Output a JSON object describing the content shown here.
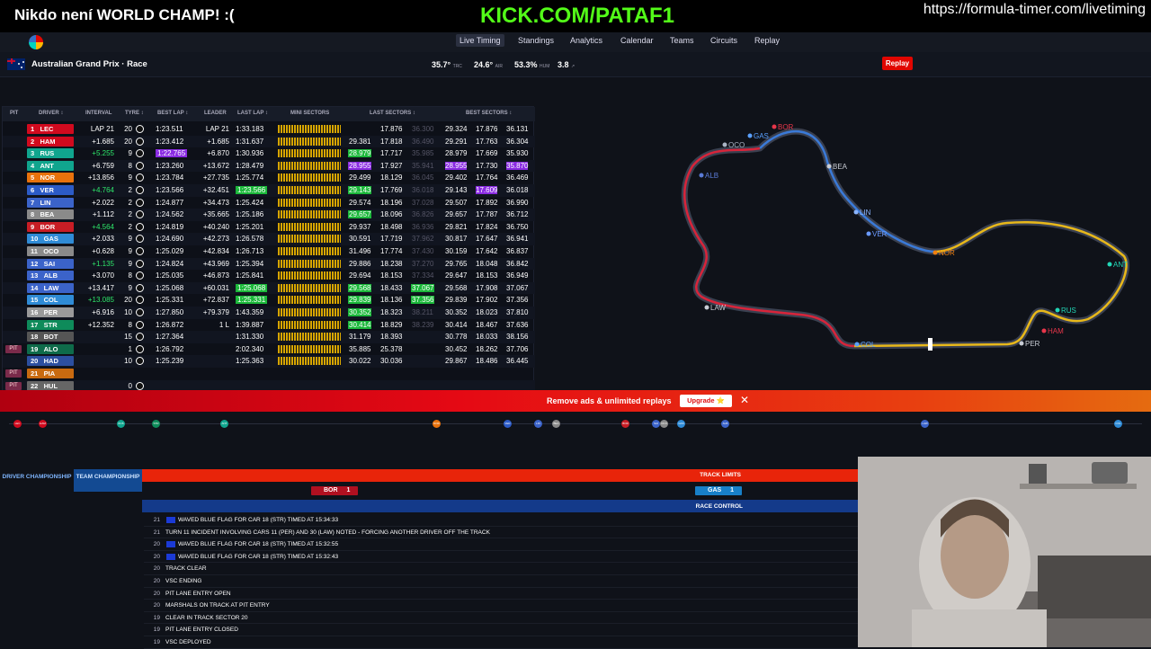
{
  "overlay": {
    "left_text": "Nikdo není WORLD CHAMP! :(",
    "center_text": "KICK.COM/PATAF1",
    "right_text": "https://formula-timer.com/livetiming"
  },
  "nav": {
    "items": [
      "Live Timing",
      "Standings",
      "Analytics",
      "Calendar",
      "Teams",
      "Circuits",
      "Replay"
    ]
  },
  "session": {
    "title": "Australian Grand Prix · Race",
    "track_temp": "35.7°",
    "track_unit": "TRC",
    "air_temp": "24.6°",
    "air_unit": "AIR",
    "humidity": "53.3%",
    "humidity_unit": "HUM",
    "wind": "3.8",
    "replay_label": "Replay"
  },
  "table": {
    "headers": [
      "PIT",
      "DRIVER ↕",
      "INTERVAL",
      "TYRE ↕",
      "BEST LAP ↕",
      "LEADER",
      "LAST LAP ↕",
      "MINI SECTORS",
      "LAST SECTORS ↕",
      "BEST SECTORS ↕"
    ],
    "rows": [
      {
        "pos": "1",
        "code": "LEC",
        "color": "#d10a1e",
        "interval": "LAP 21",
        "tl": "20",
        "best": "1:23.511",
        "leader": "LAP 21",
        "last": "1:33.183",
        "ls1": "17.876",
        "ls2": "36.300",
        "bs0": "29.324",
        "bs1": "17.876",
        "bs2": "36.131",
        "ls0": ""
      },
      {
        "pos": "2",
        "code": "HAM",
        "color": "#d10a1e",
        "interval": "+1.685",
        "tl": "20",
        "best": "1:23.412",
        "leader": "+1.685",
        "last": "1:31.637",
        "ls0": "29.381",
        "ls1": "17.818",
        "ls2": "36.490",
        "bs0": "29.291",
        "bs1": "17.763",
        "bs2": "36.304"
      },
      {
        "pos": "3",
        "code": "RUS",
        "color": "#10a58e",
        "interval": "+5.255",
        "tl": "9",
        "best": "1:22.765",
        "leader": "+6.870",
        "last": "1:30.936",
        "ls0": "28.979",
        "ls1": "17.717",
        "ls2": "35.985",
        "bs0": "28.979",
        "bs1": "17.669",
        "bs2": "35.930"
      },
      {
        "pos": "4",
        "code": "ANT",
        "color": "#10a58e",
        "interval": "+6.759",
        "tl": "8",
        "best": "1:23.260",
        "leader": "+13.672",
        "last": "1:28.479",
        "ls0": "28.955",
        "ls1": "17.927",
        "ls2": "35.941",
        "bs0": "28.955",
        "bs1": "17.730",
        "bs2": "35.870"
      },
      {
        "pos": "5",
        "code": "NOR",
        "color": "#e8720c",
        "interval": "+13.856",
        "tl": "9",
        "best": "1:23.784",
        "leader": "+27.735",
        "last": "1:25.774",
        "ls0": "29.499",
        "ls1": "18.129",
        "ls2": "36.045",
        "bs0": "29.402",
        "bs1": "17.764",
        "bs2": "36.469"
      },
      {
        "pos": "6",
        "code": "VER",
        "color": "#2c5bc7",
        "interval": "+4.764",
        "tl": "2",
        "best": "1:23.566",
        "leader": "+32.451",
        "last": "1:23.566",
        "ls0": "29.143",
        "ls1": "17.769",
        "ls2": "36.018",
        "bs0": "29.143",
        "bs1": "17.609",
        "bs2": "36.018"
      },
      {
        "pos": "7",
        "code": "LIN",
        "color": "#3b63c9",
        "interval": "+2.022",
        "tl": "2",
        "best": "1:24.877",
        "leader": "+34.473",
        "last": "1:25.424",
        "ls0": "29.574",
        "ls1": "18.196",
        "ls2": "37.028",
        "bs0": "29.507",
        "bs1": "17.892",
        "bs2": "36.990"
      },
      {
        "pos": "8",
        "code": "BEA",
        "color": "#8a8a8a",
        "interval": "+1.112",
        "tl": "2",
        "best": "1:24.562",
        "leader": "+35.665",
        "last": "1:25.186",
        "ls0": "29.657",
        "ls1": "18.096",
        "ls2": "36.826",
        "bs0": "29.657",
        "bs1": "17.787",
        "bs2": "36.712"
      },
      {
        "pos": "9",
        "code": "BOR",
        "color": "#c81d25",
        "interval": "+4.564",
        "tl": "2",
        "best": "1:24.819",
        "leader": "+40.240",
        "last": "1:25.201",
        "ls0": "29.937",
        "ls1": "18.498",
        "ls2": "36.936",
        "bs0": "29.821",
        "bs1": "17.824",
        "bs2": "36.750"
      },
      {
        "pos": "10",
        "code": "GAS",
        "color": "#2f8bd6",
        "interval": "+2.033",
        "tl": "9",
        "best": "1:24.690",
        "leader": "+42.273",
        "last": "1:26.578",
        "ls0": "30.591",
        "ls1": "17.719",
        "ls2": "37.962",
        "bs0": "30.817",
        "bs1": "17.647",
        "bs2": "36.941"
      },
      {
        "pos": "11",
        "code": "OCO",
        "color": "#8a8a8a",
        "interval": "+0.628",
        "tl": "9",
        "best": "1:25.029",
        "leader": "+42.834",
        "last": "1:26.713",
        "ls0": "31.496",
        "ls1": "17.774",
        "ls2": "37.430",
        "bs0": "30.159",
        "bs1": "17.642",
        "bs2": "36.837"
      },
      {
        "pos": "12",
        "code": "SAI",
        "color": "#3b63c9",
        "interval": "+1.135",
        "tl": "9",
        "best": "1:24.824",
        "leader": "+43.969",
        "last": "1:25.394",
        "ls0": "29.886",
        "ls1": "18.238",
        "ls2": "37.270",
        "bs0": "29.765",
        "bs1": "18.048",
        "bs2": "36.842"
      },
      {
        "pos": "13",
        "code": "ALB",
        "color": "#3b63c9",
        "interval": "+3.070",
        "tl": "8",
        "best": "1:25.035",
        "leader": "+46.873",
        "last": "1:25.841",
        "ls0": "29.694",
        "ls1": "18.153",
        "ls2": "37.334",
        "bs0": "29.647",
        "bs1": "18.153",
        "bs2": "36.949"
      },
      {
        "pos": "14",
        "code": "LAW",
        "color": "#3b63c9",
        "interval": "+13.417",
        "tl": "9",
        "best": "1:25.068",
        "leader": "+60.031",
        "last": "1:25.068",
        "ls0": "29.568",
        "ls1": "18.433",
        "ls2": "37.067",
        "bs0": "29.568",
        "bs1": "17.908",
        "bs2": "37.067"
      },
      {
        "pos": "15",
        "code": "COL",
        "color": "#2f8bd6",
        "interval": "+13.085",
        "tl": "20",
        "best": "1:25.331",
        "leader": "+72.837",
        "last": "1:25.331",
        "ls0": "29.839",
        "ls1": "18.136",
        "ls2": "37.356",
        "bs0": "29.839",
        "bs1": "17.902",
        "bs2": "37.356"
      },
      {
        "pos": "16",
        "code": "PER",
        "color": "#9a9a9a",
        "interval": "+6.916",
        "tl": "10",
        "best": "1:27.850",
        "leader": "+79.379",
        "last": "1:43.359",
        "ls0": "30.352",
        "ls1": "18.323",
        "ls2": "38.211",
        "bs0": "30.352",
        "bs1": "18.023",
        "bs2": "37.810"
      },
      {
        "pos": "17",
        "code": "STR",
        "color": "#0e8b5a",
        "interval": "+12.352",
        "tl": "8",
        "best": "1:26.872",
        "leader": "1 L",
        "last": "1:39.887",
        "ls0": "30.414",
        "ls1": "18.829",
        "ls2": "38.239",
        "bs0": "30.414",
        "bs1": "18.467",
        "bs2": "37.636"
      },
      {
        "pos": "18",
        "code": "BOT",
        "color": "#555555",
        "interval": "",
        "tl": "15",
        "best": "1:27.364",
        "leader": "",
        "last": "1:31.330",
        "ls0": "31.179",
        "ls1": "18.393",
        "ls2": "",
        "bs0": "30.778",
        "bs1": "18.033",
        "bs2": "38.156"
      },
      {
        "pos": "19",
        "code": "ALO",
        "color": "#0e6b4a",
        "interval": "",
        "tl": "1",
        "best": "1:26.792",
        "leader": "",
        "last": "2:02.340",
        "ls0": "35.885",
        "ls1": "25.378",
        "ls2": "",
        "bs0": "30.452",
        "bs1": "18.262",
        "bs2": "37.706",
        "pit": "PIT"
      },
      {
        "pos": "20",
        "code": "HAD",
        "color": "#2c4fa0",
        "interval": "",
        "tl": "10",
        "best": "1:25.239",
        "leader": "",
        "last": "1:25.363",
        "ls0": "30.022",
        "ls1": "30.036",
        "ls2": "",
        "bs0": "29.867",
        "bs1": "18.486",
        "bs2": "36.445"
      },
      {
        "pos": "21",
        "code": "PIA",
        "color": "#c86a10",
        "interval": "",
        "tl": "",
        "best": "",
        "leader": "",
        "last": "",
        "ls0": "",
        "ls1": "",
        "ls2": "",
        "bs0": "",
        "bs1": "",
        "bs2": "",
        "pit": "PIT"
      },
      {
        "pos": "22",
        "code": "HUL",
        "color": "#666666",
        "interval": "",
        "tl": "0",
        "best": "",
        "leader": "",
        "last": "",
        "ls0": "",
        "ls1": "",
        "ls2": "",
        "bs0": "",
        "bs1": "",
        "bs2": "",
        "pit": "PIT"
      }
    ]
  },
  "track": {
    "labels": [
      {
        "code": "BOR",
        "color": "#e8364a"
      },
      {
        "code": "GAS",
        "color": "#5aa0ff"
      },
      {
        "code": "OCO",
        "color": "#aab4c4"
      },
      {
        "code": "BEA",
        "color": "#c8ccd4"
      },
      {
        "code": "ALB",
        "color": "#5a7bd6"
      },
      {
        "code": "LIN",
        "color": "#8ab4ff"
      },
      {
        "code": "VER",
        "color": "#6a9aff"
      },
      {
        "code": "NOR",
        "color": "#f08010"
      },
      {
        "code": "ANT",
        "color": "#22d6b6"
      },
      {
        "code": "LAW",
        "color": "#c8ccd4"
      },
      {
        "code": "RUS",
        "color": "#22d6b6"
      },
      {
        "code": "HAM",
        "color": "#e8364a"
      },
      {
        "code": "PER",
        "color": "#c8ccd4"
      },
      {
        "code": "COL",
        "color": "#5aa0ff"
      }
    ]
  },
  "promo": {
    "text": "Remove ads & unlimited replays",
    "button": "Upgrade ⭐",
    "close": "✕"
  },
  "gap_dots": [
    "LEC",
    "HAM",
    "RUS",
    "STR",
    "ANT",
    "NOR",
    "VER",
    "LIN",
    "BEA",
    "BOR",
    "GAS",
    "OCO",
    "SAI",
    "ALB",
    "LAW",
    "COL"
  ],
  "bottom": {
    "driver_champ": "DRIVER CHAMPIONSHIP",
    "team_champ": "TEAM CHAMPIONSHIP",
    "track_limits_label": "TRACK LIMITS",
    "tl_chips": [
      {
        "code": "BOR",
        "count": "1"
      },
      {
        "code": "GAS",
        "count": "1"
      }
    ],
    "race_control_label": "RACE CONTROL",
    "messages": [
      {
        "lap": "21",
        "text": "WAVED BLUE FLAG FOR CAR 18 (STR) TIMED AT 15:34:33",
        "flag": true
      },
      {
        "lap": "21",
        "text": "TURN 11 INCIDENT INVOLVING CARS 11 (PER) AND 30 (LAW) NOTED - FORCING ANOTHER DRIVER OFF THE TRACK",
        "flag": false
      },
      {
        "lap": "20",
        "text": "WAVED BLUE FLAG FOR CAR 18 (STR) TIMED AT 15:32:55",
        "flag": true
      },
      {
        "lap": "20",
        "text": "WAVED BLUE FLAG FOR CAR 18 (STR) TIMED AT 15:32:43",
        "flag": true
      },
      {
        "lap": "20",
        "text": "TRACK CLEAR",
        "flag": false
      },
      {
        "lap": "20",
        "text": "VSC ENDING",
        "flag": false
      },
      {
        "lap": "20",
        "text": "PIT LANE ENTRY OPEN",
        "flag": false
      },
      {
        "lap": "20",
        "text": "MARSHALS ON TRACK AT PIT ENTRY",
        "flag": false
      },
      {
        "lap": "19",
        "text": "CLEAR IN TRACK SECTOR 20",
        "flag": false
      },
      {
        "lap": "19",
        "text": "PIT LANE ENTRY CLOSED",
        "flag": false
      },
      {
        "lap": "19",
        "text": "VSC DEPLOYED",
        "flag": false
      }
    ]
  }
}
